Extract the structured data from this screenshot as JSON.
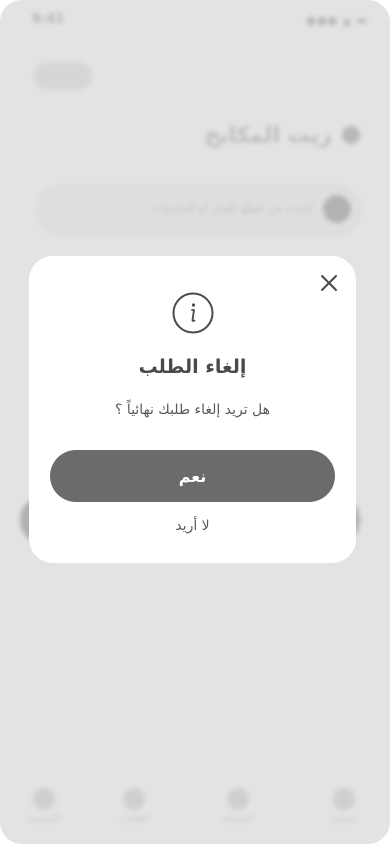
{
  "background": {
    "status_time": "9:41",
    "status_icons": "●●● ▲ ▬",
    "back_label": "",
    "page_title": "زيت المكابح",
    "search_placeholder": "ابحث عن قطع الغيار أو الخدمات",
    "nav": [
      {
        "label": "الرئيسية"
      },
      {
        "label": "الطلبات"
      },
      {
        "label": "المفضلة"
      },
      {
        "label": "حسابي"
      }
    ]
  },
  "dialog": {
    "title": "إلغاء الطلب",
    "message": "هل تريد إلغاء طلبك نهائياً ؟",
    "confirm_label": "نعم",
    "cancel_label": "لا أريد"
  },
  "colors": {
    "overlay": "#e3e3e3",
    "confirm_button": "#6b6b6b",
    "title_text": "#4a4a4a"
  }
}
